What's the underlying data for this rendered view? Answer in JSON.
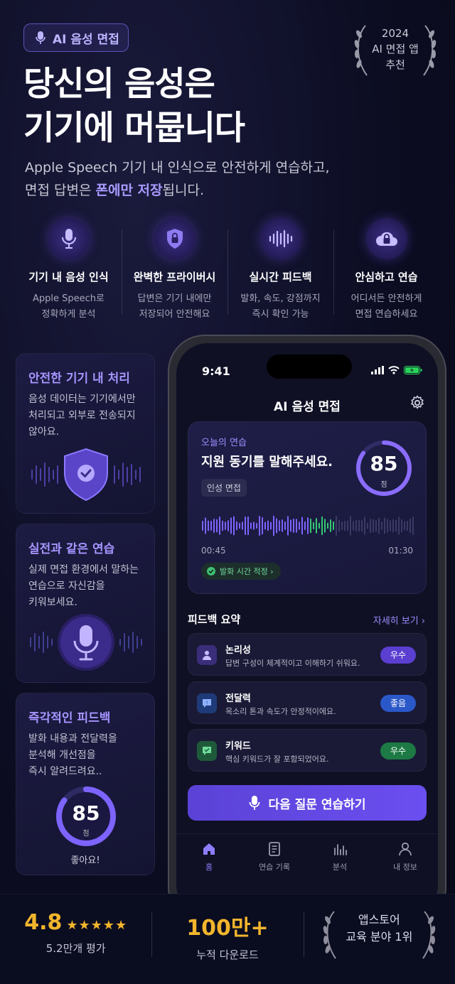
{
  "badge": {
    "label": "AI 음성 면접"
  },
  "award": {
    "year": "2024",
    "line1": "AI 면접 앱",
    "line2": "추천"
  },
  "headline": {
    "line1": "당신의 음성은",
    "line2": "기기에 머뭅니다"
  },
  "subtitle": {
    "line1": "Apple Speech 기기 내 인식으로 안전하게 연습하고,",
    "line2_pre": "면접 답변은 ",
    "line2_highlight": "폰에만 저장",
    "line2_post": "됩니다."
  },
  "features": [
    {
      "icon": "mic-icon",
      "title": "기기 내 음성 인식",
      "desc1": "Apple Speech로",
      "desc2": "정확하게 분석"
    },
    {
      "icon": "shield-lock-icon",
      "title": "완벽한 프라이버시",
      "desc1": "답변은 기기 내에만",
      "desc2": "저장되어 안전해요"
    },
    {
      "icon": "waveform-icon",
      "title": "실시간 피드백",
      "desc1": "발화, 속도, 강점까지",
      "desc2": "즉시 확인 가능"
    },
    {
      "icon": "cloud-lock-icon",
      "title": "안심하고 연습",
      "desc1": "어디서든 안전하게",
      "desc2": "면접 연습하세요"
    }
  ],
  "cards": [
    {
      "title": "안전한 기기 내 처리",
      "desc1": "음성 데이터는 기기에서만",
      "desc2": "처리되고 외부로 전송되지",
      "desc3": "않아요."
    },
    {
      "title": "실전과 같은 연습",
      "desc1": "실제 면접 환경에서 말하는",
      "desc2": "연습으로 자신감을",
      "desc3": "키워보세요."
    },
    {
      "title": "즉각적인 피드백",
      "desc1": "발화 내용과 전달력을",
      "desc2": "분석해 개선점을",
      "desc3": "즉시 알려드려요..",
      "score": "85",
      "score_unit": "점",
      "score_caption": "좋아요!",
      "score_value": 0.85
    }
  ],
  "phone": {
    "time": "9:41",
    "app_title": "AI 음성 면접",
    "practice": {
      "label": "오늘의 연습",
      "question": "지원 동기를 말해주세요.",
      "tag": "인성 면접",
      "score": "85",
      "score_unit": "점",
      "score_value": 0.85,
      "elapsed": "00:45",
      "total": "01:30",
      "status": "발화 시간 적정 ›"
    },
    "feedback": {
      "title": "피드백 요약",
      "more": "자세히 보기 ›",
      "items": [
        {
          "name": "논리성",
          "desc": "답변 구성이 체계적이고 이해하기 쉬워요.",
          "badge": "우수",
          "badge_color": "#5a3fd0",
          "icon_bg": "#3a2d7a"
        },
        {
          "name": "전달력",
          "desc": "목소리 톤과 속도가 안정적이에요.",
          "badge": "좋음",
          "badge_color": "#2a58c8",
          "icon_bg": "#1f3a78"
        },
        {
          "name": "키워드",
          "desc": "핵심 키워드가 잘 포함되었어요.",
          "badge": "우수",
          "badge_color": "#1d7a45",
          "icon_bg": "#1e5a3a"
        }
      ]
    },
    "cta": "다음 질문 연습하기",
    "tabs": [
      {
        "label": "홈",
        "icon": "home-icon"
      },
      {
        "label": "연습 기록",
        "icon": "document-icon"
      },
      {
        "label": "분석",
        "icon": "chart-icon"
      },
      {
        "label": "내 정보",
        "icon": "person-icon"
      }
    ]
  },
  "stats": {
    "rating": "4.8",
    "stars": "★★★★★",
    "rating_count": "5.2만개 평가",
    "downloads": "100만+",
    "downloads_label": "누적 다운로드",
    "rank_line1": "앱스토어",
    "rank_line2": "교육 분야 1위"
  },
  "colors": {
    "accent": "#8f7dff",
    "gold": "#f2b52c",
    "background": "#0c0d22"
  }
}
